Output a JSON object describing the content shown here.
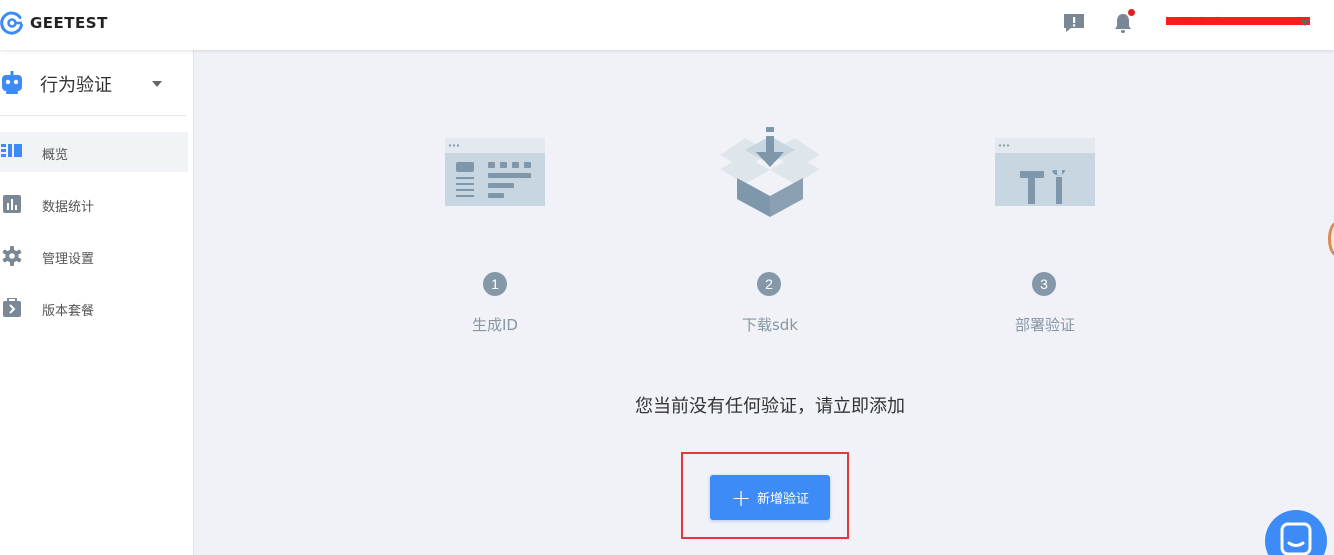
{
  "header": {
    "logo_text": "GEETEST",
    "feedback_icon": "feedback-icon",
    "bell_icon": "bell-icon",
    "user_name": "redacted user",
    "accent": "#3d8bf7"
  },
  "sidebar": {
    "product_name": "行为验证",
    "items": [
      {
        "label": "概览",
        "icon": "overview-icon",
        "active": true
      },
      {
        "label": "数据统计",
        "icon": "stats-icon",
        "active": false
      },
      {
        "label": "管理设置",
        "icon": "gear-icon",
        "active": false
      },
      {
        "label": "版本套餐",
        "icon": "package-icon",
        "active": false
      }
    ]
  },
  "main": {
    "steps": [
      {
        "number": "1",
        "label": "生成ID",
        "icon": "generate-id-illustration"
      },
      {
        "number": "2",
        "label": "下载sdk",
        "icon": "download-sdk-illustration"
      },
      {
        "number": "3",
        "label": "部署验证",
        "icon": "deploy-illustration"
      }
    ],
    "empty_message": "您当前没有任何验证，请立即添加",
    "add_button": {
      "plus": "+",
      "label": "新增验证"
    }
  },
  "colors": {
    "brand_blue": "#3d8bf7",
    "step_gray": "#8598a8",
    "highlight_red": "#e03a3a"
  }
}
